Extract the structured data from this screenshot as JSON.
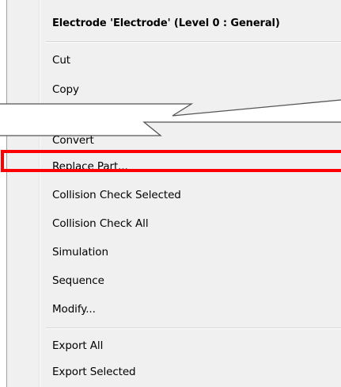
{
  "menu": {
    "header": "Electrode 'Electrode' (Level 0 : General)",
    "items": {
      "cut": "Cut",
      "copy": "Copy",
      "convert": "Convert",
      "replace_part": "Replace Part...",
      "collision_check_selected": "Collision Check Selected",
      "collision_check_all": "Collision Check All",
      "simulation": "Simulation",
      "sequence": "Sequence",
      "modify": "Modify...",
      "export_all": "Export All",
      "export_selected": "Export Selected"
    }
  },
  "colors": {
    "menu_background": "#f0f0f0",
    "highlight_border": "#ff0000",
    "tear_gap": "#ffffff"
  }
}
